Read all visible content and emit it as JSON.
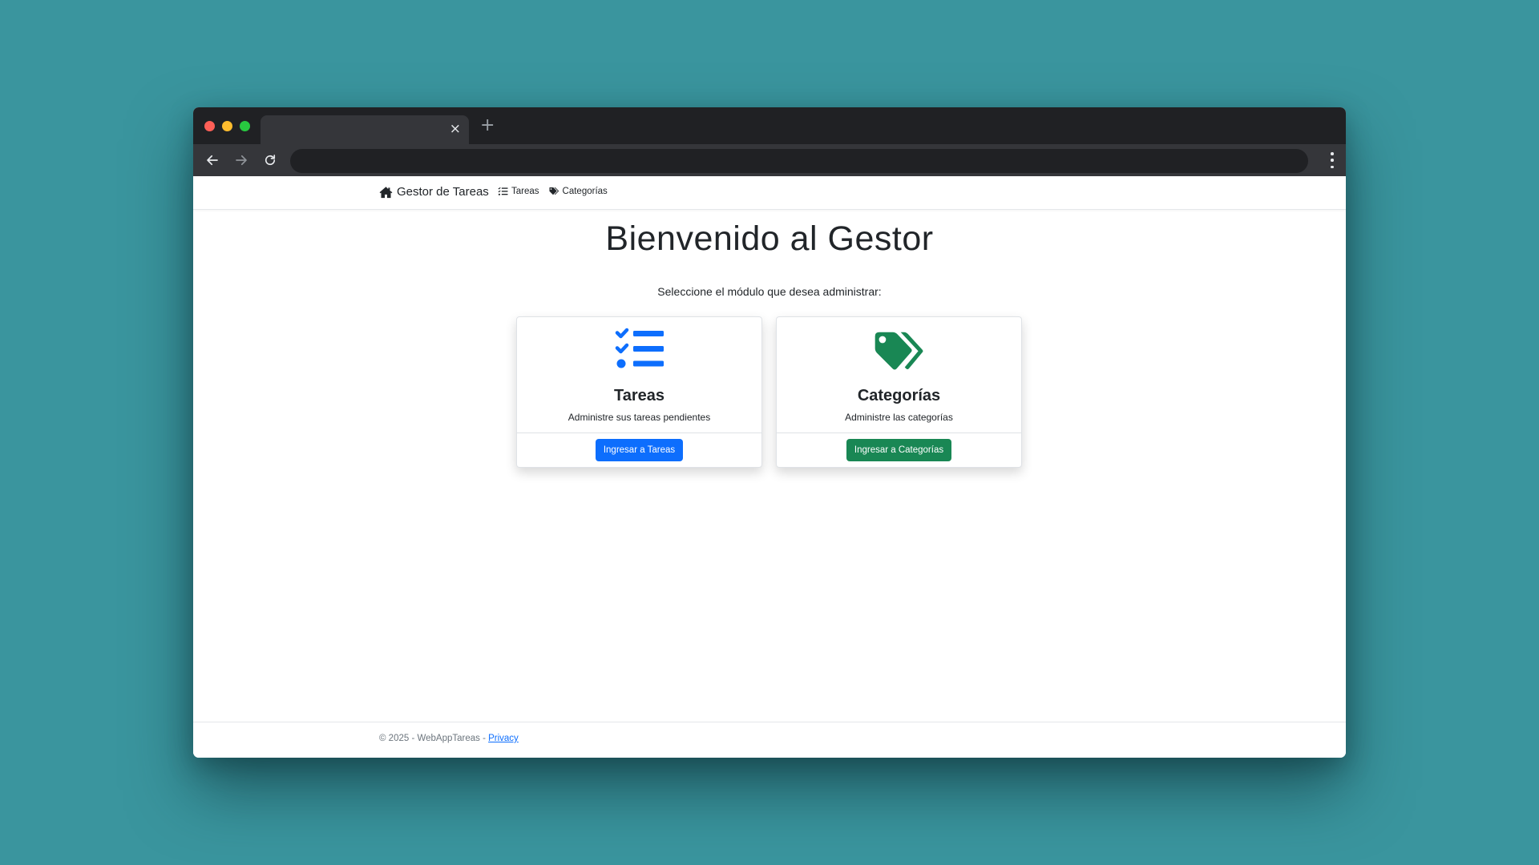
{
  "browser": {
    "tab_close": "×",
    "new_tab": "+"
  },
  "navbar": {
    "brand": "Gestor de Tareas",
    "links": [
      {
        "label": "Tareas",
        "icon": "list-check-icon"
      },
      {
        "label": "Categorías",
        "icon": "tags-icon"
      }
    ]
  },
  "hero": {
    "title": "Bienvenido al Gestor",
    "subtitle": "Seleccione el módulo que desea administrar:"
  },
  "cards": [
    {
      "title": "Tareas",
      "description": "Administre sus tareas pendientes",
      "button": "Ingresar a Tareas",
      "icon": "list-check-icon",
      "color": "#0d6efd"
    },
    {
      "title": "Categorías",
      "description": "Administre las categorías",
      "button": "Ingresar a Categorías",
      "icon": "tags-icon",
      "color": "#198754"
    }
  ],
  "footer": {
    "copyright": "© 2025 - WebAppTareas - ",
    "privacy": "Privacy"
  },
  "colors": {
    "background": "#3a959e",
    "primary": "#0d6efd",
    "success": "#198754"
  }
}
